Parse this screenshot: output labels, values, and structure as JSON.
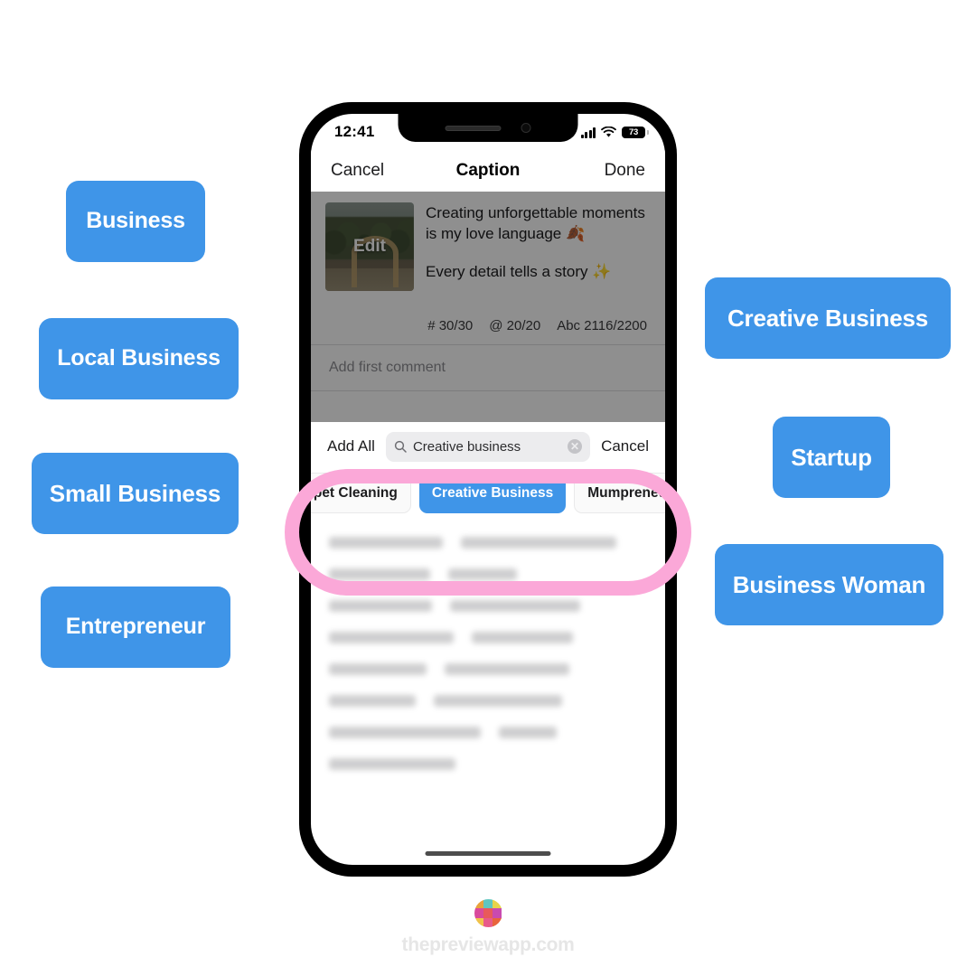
{
  "colors": {
    "accent_blue": "#3f95e8",
    "highlight_pink": "#fba8d8",
    "chip_selected_blue": "#3f95e8",
    "watermark_grey": "#e6e6e6"
  },
  "left_labels": [
    {
      "text": "Business"
    },
    {
      "text": "Local Business"
    },
    {
      "text": "Small Business"
    },
    {
      "text": "Entrepreneur"
    }
  ],
  "right_labels": [
    {
      "text": "Creative Business"
    },
    {
      "text": "Startup"
    },
    {
      "text": "Business Woman"
    }
  ],
  "phone": {
    "status_bar": {
      "time": "12:41",
      "battery_level": "73",
      "signal_icon": "cellular-bars-icon",
      "wifi_icon": "wifi-icon",
      "battery_icon": "battery-icon"
    },
    "nav_bar": {
      "cancel_label": "Cancel",
      "title": "Caption",
      "done_label": "Done"
    },
    "caption": {
      "thumbnail_overlay_label": "Edit",
      "thumbnail_icon": "photo-thumbnail",
      "line_1": "Creating unforgettable moments is my love language 🍂",
      "line_2": "Every detail tells a story ✨"
    },
    "counters": {
      "hashtags": "# 30/30",
      "mentions": "@ 20/20",
      "characters": "Abc 2116/2200"
    },
    "first_comment_placeholder": "Add first comment",
    "tag_panel": {
      "add_all_label": "Add All",
      "search": {
        "icon": "search-icon",
        "value": "Creative business",
        "clear_icon": "clear-circle-icon"
      },
      "cancel_label": "Cancel",
      "chips": [
        {
          "label": "Carpet Cleaning",
          "selected": false
        },
        {
          "label": "Creative Business",
          "selected": true
        },
        {
          "label": "Mumpreneur",
          "selected": false
        }
      ]
    }
  },
  "footer": {
    "logo_icon": "preview-app-logo",
    "text": "thepreviewapp.com"
  }
}
